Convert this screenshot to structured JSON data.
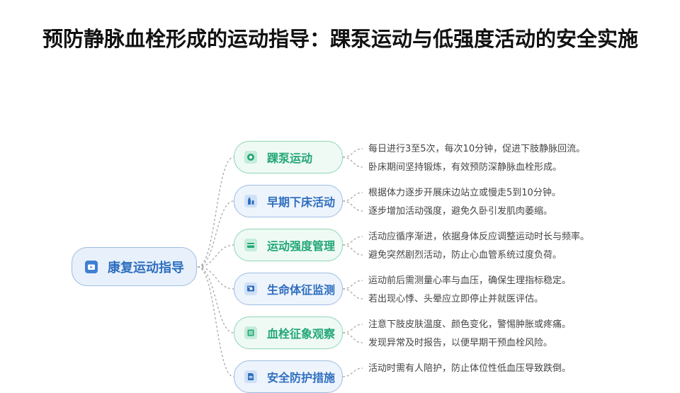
{
  "title": "预防静脉血栓形成的运动指导：踝泵运动与低强度活动的安全实施",
  "mindmap": {
    "root": {
      "label": "康复运动指导",
      "icon": "tv-icon"
    },
    "branches": [
      {
        "label": "踝泵运动",
        "icon": "circle-target-icon",
        "tone": "green",
        "details": [
          "每日进行3至5次，每次10分钟，促进下肢静脉回流。",
          "卧床期间坚持锻炼，有效预防深静脉血栓形成。"
        ]
      },
      {
        "label": "早期下床活动",
        "icon": "bottle-icon",
        "tone": "blue",
        "details": [
          "根据体力逐步开展床边站立或慢走5到10分钟。",
          "逐步增加活动强度，避免久卧引发肌肉萎缩。"
        ]
      },
      {
        "label": "运动强度管理",
        "icon": "card-icon",
        "tone": "green",
        "details": [
          "活动应循序渐进，依据身体反应调整运动时长与频率。",
          "避免突然剧烈活动，防止心血管系统过度负荷。"
        ]
      },
      {
        "label": "生命体征监测",
        "icon": "monitor-icon",
        "tone": "blue",
        "details": [
          "运动前后需测量心率与血压，确保生理指标稳定。",
          "若出现心悸、头晕应立即停止并就医评估。"
        ]
      },
      {
        "label": "血栓征象观察",
        "icon": "list-icon",
        "tone": "green",
        "details": [
          "注意下肢皮肤温度、颜色变化，警惕肿胀或疼痛。",
          "发现异常及时报告，以便早期干预血栓风险。"
        ]
      },
      {
        "label": "安全防护措施",
        "icon": "document-icon",
        "tone": "blue",
        "details": [
          "活动时需有人陪护，防止体位性低血压导致跌倒。"
        ]
      }
    ]
  },
  "colors": {
    "green": "#22a776",
    "blue": "#2f6fbf",
    "connector": "#a8a8a8"
  }
}
